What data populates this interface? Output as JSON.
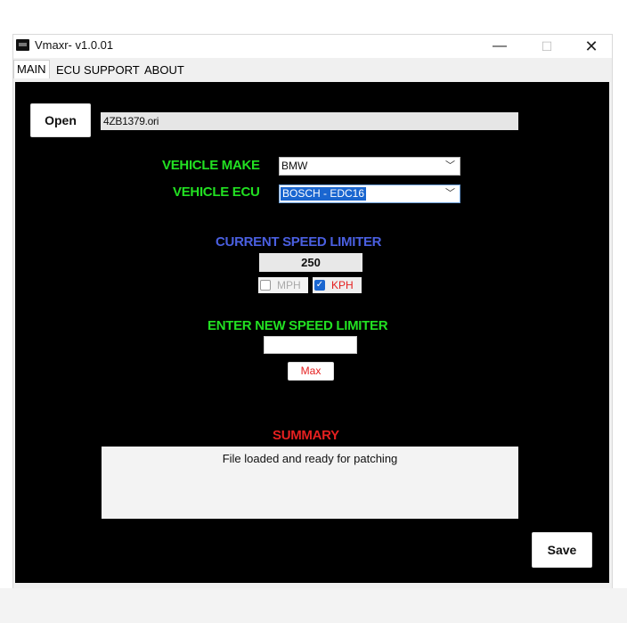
{
  "window": {
    "title": "Vmaxr- v1.0.01"
  },
  "tabs": [
    {
      "label": "MAIN",
      "active": true
    },
    {
      "label": "ECU SUPPORT",
      "active": false
    },
    {
      "label": "ABOUT",
      "active": false
    }
  ],
  "main": {
    "open_label": "Open",
    "file_name": "4ZB1379.ori",
    "vehicle_make_label": "VEHICLE MAKE",
    "vehicle_make_value": "BMW",
    "vehicle_ecu_label": "VEHICLE ECU",
    "vehicle_ecu_value": "BOSCH - EDC16",
    "current_limiter_label": "CURRENT SPEED LIMITER",
    "current_limiter_value": "250",
    "unit_mph_label": "MPH",
    "unit_mph_checked": false,
    "unit_kph_label": "KPH",
    "unit_kph_checked": true,
    "new_limiter_label": "ENTER NEW SPEED LIMITER",
    "new_limiter_value": "",
    "max_label": "Max",
    "summary_label": "SUMMARY",
    "summary_text": "File loaded and ready for patching",
    "save_label": "Save"
  },
  "colors": {
    "panel_bg": "#000000",
    "label_green": "#22e022",
    "label_blue": "#4a5fe0",
    "label_red": "#e52020",
    "selection_blue": "#1a66d0"
  },
  "icons": {
    "app": "app-logo-icon",
    "minimize": "minimize-icon",
    "maximize": "maximize-icon",
    "close": "close-icon",
    "dropdown": "chevron-down-icon",
    "check": "checkmark-icon"
  }
}
